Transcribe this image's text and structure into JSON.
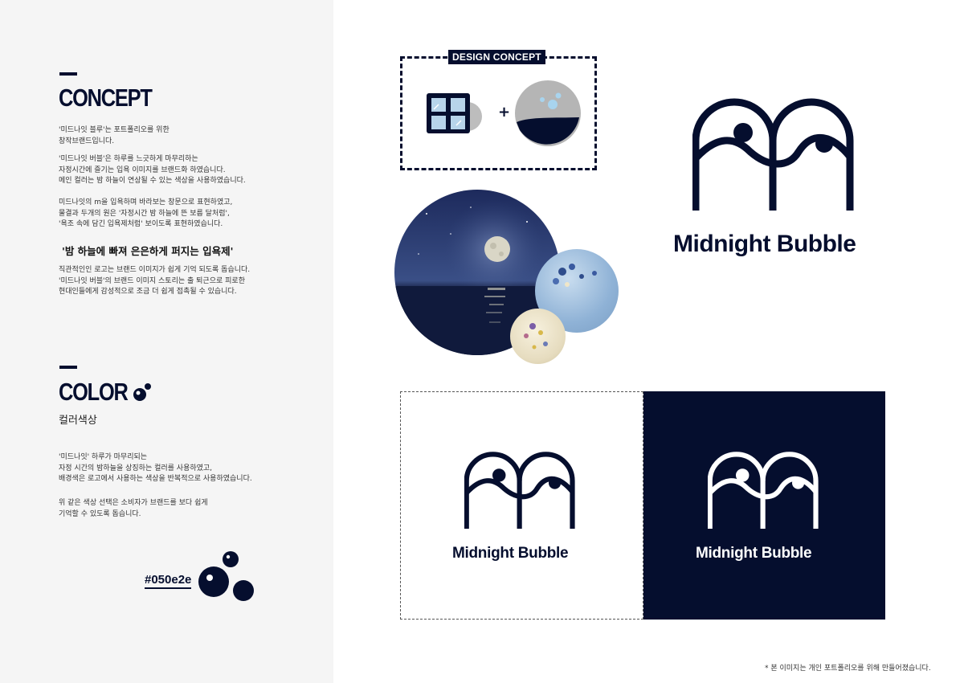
{
  "concept": {
    "heading": "CONCEPT",
    "para1": "'미드나잇 블루'는 포트폴리오를 위한\n창작브랜드입니다.",
    "para2": "'미드나잇 버블'은 하루를 느긋하게 마무리하는\n자정시간에 즐기는 입욕 이미지를 브랜드화 하였습니다.\n메인 컬러는 밤 하늘이 연상될 수 있는 색상을 사용하였습니다.",
    "para3": "미드나잇의 m을 입욕하며 바라보는 창문으로 표현하였고,\n물결과 두개의 원은 '자정시간 밤 하늘에 뜬 보름 달처럼',\n'욕조 속에 담긴 입욕제처럼' 보이도록 표현하였습니다.",
    "highlight": "'밤 하늘에 빠져 은은하게 퍼지는 입욕제'",
    "para4": "직관적인인 로고는 브랜드 이미지가 쉽게 기억 되도록 돕습니다.\n'미드나잇 버블'의 브랜드 이미지 스토리는 출 퇴근으로 피로한\n현대인들에게 감성적으로 조금 더 쉽게 접촉될 수 있습니다."
  },
  "color": {
    "heading": "COLOR",
    "subheading": "컬러색상",
    "para1": "'미드나잇' 하루가 마무리되는\n자정 시간의 밤하늘을 상징하는 컬러를 사용하였고,\n배경색은 로고에서 사용하는 색상을 반복적으로 사용하였습니다.",
    "para2": "위 같은 색상 선택은 소비자가 브랜드를 보다 쉽게\n기억할 수 있도록 돕습니다.",
    "hex_label": "#050e2e",
    "swatch": "#050e2e"
  },
  "design_concept": {
    "label": "DESIGN CONCEPT",
    "plus": "+"
  },
  "logo": {
    "brand_name": "Midnight Bubble"
  },
  "cards": {
    "light_text": "Midnight Bubble",
    "dark_text": "Midnight Bubble"
  },
  "footnote": "* 본 이미지는 개인 포트폴리오를 위해 만들어졌습니다.",
  "colors": {
    "navy": "#050e2e",
    "panel": "#f5f5f5",
    "white": "#ffffff"
  }
}
